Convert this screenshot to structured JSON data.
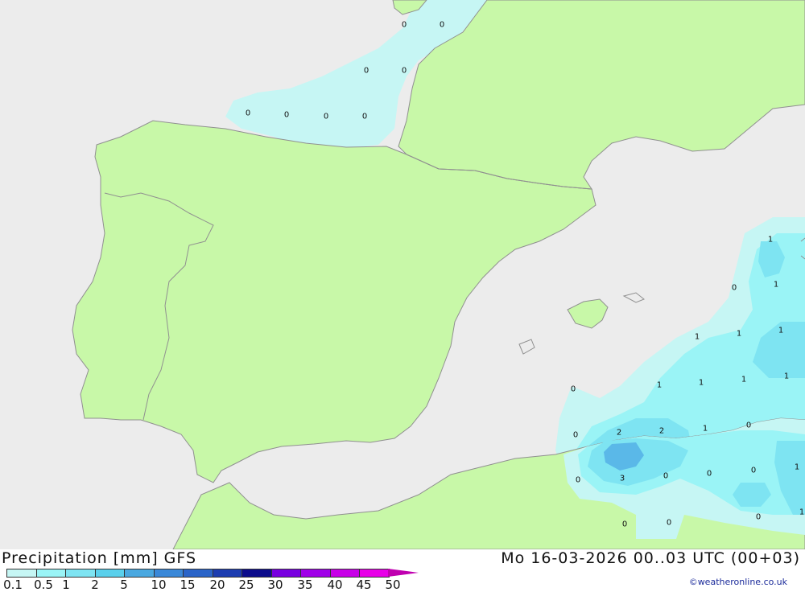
{
  "map": {
    "colors": {
      "sea": "#ececec",
      "land": "#c8f8a8",
      "coast": "#909090",
      "precip_level_0_1": "#c6f6f4",
      "precip_level_0_5": "#9af4f6",
      "precip_level_1": "#7ee4f2",
      "precip_level_2": "#5ab8e8"
    },
    "contour_labels": [
      "0",
      "0",
      "0",
      "0",
      "0",
      "0",
      "0",
      "0",
      "0",
      "1",
      "0",
      "1",
      "1",
      "1",
      "1",
      "0",
      "1",
      "1",
      "1",
      "1",
      "0",
      "2",
      "2",
      "1",
      "0",
      "0",
      "3",
      "0",
      "0",
      "0",
      "1",
      "0",
      "1",
      "0",
      "0"
    ]
  },
  "footer": {
    "title_left": "Precipitation [mm] GFS",
    "title_right": "Mo 16-03-2026 00..03 UTC (00+03)",
    "credit": "©weatheronline.co.uk"
  },
  "legend": {
    "ticks": [
      "0.1",
      "0.5",
      "1",
      "2",
      "5",
      "10",
      "15",
      "20",
      "25",
      "30",
      "35",
      "40",
      "45",
      "50"
    ],
    "colors": [
      "#c6f6f4",
      "#9af4f6",
      "#7ee4f2",
      "#5ad0ec",
      "#4aa8e0",
      "#3a88d8",
      "#2a64c8",
      "#1c3cb0",
      "#0c0c8c",
      "#7800e0",
      "#a000e8",
      "#c800e8",
      "#e800e8",
      "#c000b0"
    ]
  }
}
